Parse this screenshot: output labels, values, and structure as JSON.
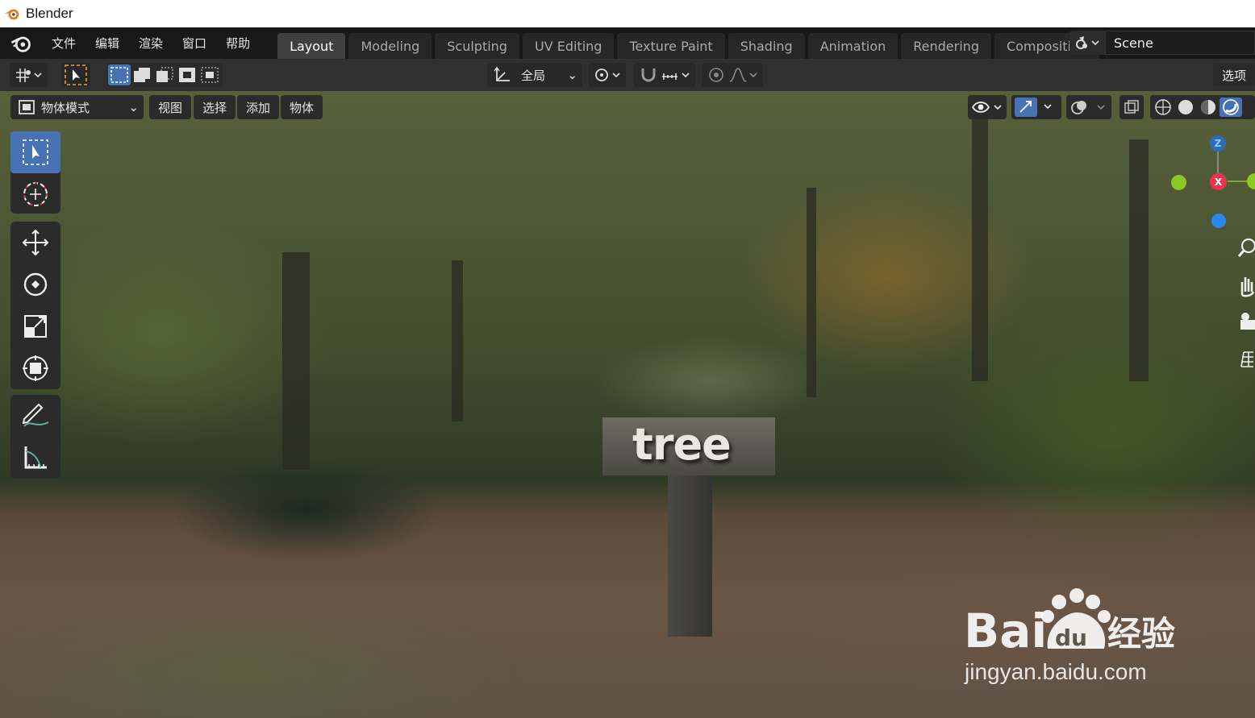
{
  "window": {
    "title": "Blender"
  },
  "menubar": {
    "items": [
      "文件",
      "编辑",
      "渲染",
      "窗口",
      "帮助"
    ],
    "tabs": [
      {
        "label": "Layout",
        "active": true
      },
      {
        "label": "Modeling"
      },
      {
        "label": "Sculpting"
      },
      {
        "label": "UV Editing"
      },
      {
        "label": "Texture Paint"
      },
      {
        "label": "Shading"
      },
      {
        "label": "Animation"
      },
      {
        "label": "Rendering"
      },
      {
        "label": "Compositing"
      }
    ],
    "scene": "Scene"
  },
  "toolheader": {
    "orientation": "全局",
    "options_label": "选项"
  },
  "viewport_header": {
    "mode": "物体模式",
    "menus": [
      "视图",
      "选择",
      "添加",
      "物体"
    ]
  },
  "gizmo": {
    "z": "Z",
    "x": "X"
  },
  "scene_object": {
    "sign_text": "tree"
  },
  "watermark": {
    "brand": "Bai",
    "brand_du": "du",
    "brand_cn": "经验",
    "url": "jingyan.baidu.com"
  },
  "colors": {
    "active_tab": "#3f3f3f",
    "active_tool": "#4772b3",
    "axis_x": "#e8344f",
    "axis_y": "#8bc923",
    "axis_z": "#2c86f0"
  }
}
